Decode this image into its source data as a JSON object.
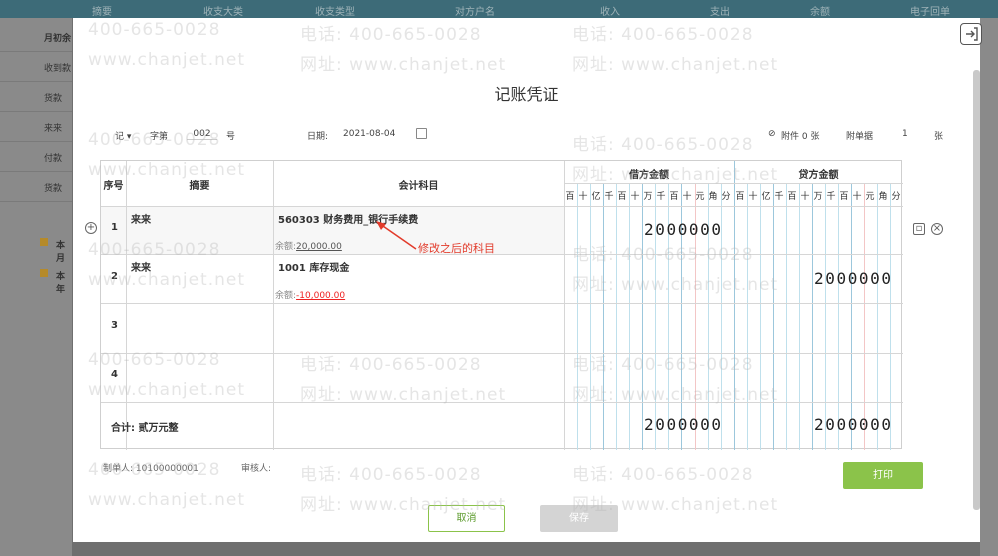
{
  "background": {
    "top_columns": [
      "摘要",
      "收支大类",
      "收支类型",
      "对方户名",
      "收入",
      "支出",
      "余额",
      "电子回单"
    ],
    "side_rows": [
      "月初余",
      "收到款",
      "货款",
      "来来",
      "付款",
      "货款"
    ],
    "groups": [
      "本月",
      "本年"
    ]
  },
  "modal": {
    "title": "记账凭证",
    "header": {
      "voucher_word": "记",
      "number_label": "字第",
      "number": "002",
      "number_suffix": "号",
      "date_label": "日期:",
      "date": "2021-08-04",
      "attachment_label": "附件 0 张",
      "extra_label": "附单据",
      "extra_value": "1",
      "extra_suffix": "张"
    },
    "table": {
      "col_seq": "序号",
      "col_summary": "摘要",
      "col_account": "会计科目",
      "col_debit": "借方金额",
      "col_credit": "贷方金额",
      "digit_units": [
        "百",
        "十",
        "亿",
        "千",
        "百",
        "十",
        "万",
        "千",
        "百",
        "十",
        "元",
        "角",
        "分"
      ],
      "rows": [
        {
          "seq": "1",
          "summary": "来来",
          "account": "560303 财务费用_银行手续费",
          "balance_label": "余额:",
          "balance": "20,000.00",
          "debit": "2000000",
          "credit": ""
        },
        {
          "seq": "2",
          "summary": "来来",
          "account": "1001 库存现金",
          "balance_label": "余额:",
          "balance": "-10,000.00",
          "debit": "",
          "credit": "2000000"
        },
        {
          "seq": "3",
          "summary": "",
          "account": "",
          "balance_label": "",
          "balance": "",
          "debit": "",
          "credit": ""
        },
        {
          "seq": "4",
          "summary": "",
          "account": "",
          "balance_label": "",
          "balance": "",
          "debit": "",
          "credit": ""
        }
      ],
      "total_label": "合计:  贰万元整",
      "total_debit": "2000000",
      "total_credit": "2000000"
    },
    "annotation": "修改之后的科目",
    "preparer": "制单人: 10100000001",
    "reviewer": "审核人:",
    "buttons": {
      "print": "打印",
      "cancel": "取消",
      "save": "保存"
    }
  },
  "watermark": {
    "phone": "电话: 400-665-0028",
    "site": "网址: www.chanjet.net",
    "phone_short": "400-665-0028",
    "site_short": "www.chanjet.net"
  },
  "colors": {
    "accent": "#8bc34a",
    "annotation": "#e23b2b",
    "header_bar": "#3d6b78"
  }
}
